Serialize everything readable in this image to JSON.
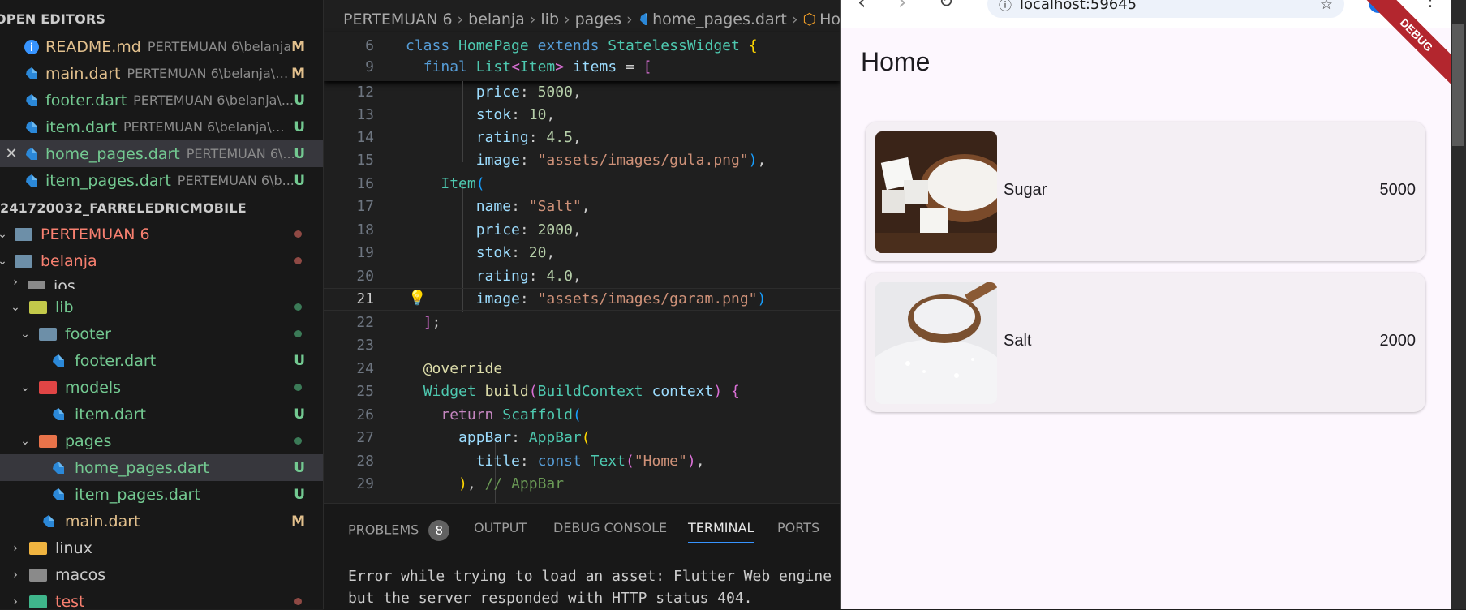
{
  "sidebar": {
    "open_editors_title": "OPEN EDITORS",
    "open_editors": [
      {
        "name": "README.md",
        "path": "PERTEMUAN 6\\belanja",
        "badge": "M",
        "icon": "info-icon"
      },
      {
        "name": "main.dart",
        "path": "PERTEMUAN 6\\belanja\\lib",
        "badge": "M",
        "icon": "dart-icon"
      },
      {
        "name": "footer.dart",
        "path": "PERTEMUAN 6\\belanja\\...",
        "badge": "U",
        "icon": "dart-icon"
      },
      {
        "name": "item.dart",
        "path": "PERTEMUAN 6\\belanja\\li...",
        "badge": "U",
        "icon": "dart-icon"
      },
      {
        "name": "home_pages.dart",
        "path": "PERTEMUAN 6\\...",
        "badge": "U",
        "icon": "dart-icon"
      },
      {
        "name": "item_pages.dart",
        "path": "PERTEMUAN 6\\b...",
        "badge": "U",
        "icon": "dart-icon"
      }
    ],
    "workspace_title": "241720032_FARRELEDRICMOBILE",
    "tree": [
      {
        "label": "PERTEMUAN 6"
      },
      {
        "label": "belanja"
      },
      {
        "label": "ios"
      },
      {
        "label": "lib"
      },
      {
        "label": "footer"
      },
      {
        "label": "footer.dart",
        "badge": "U"
      },
      {
        "label": "models"
      },
      {
        "label": "item.dart",
        "badge": "U"
      },
      {
        "label": "pages"
      },
      {
        "label": "home_pages.dart",
        "badge": "U"
      },
      {
        "label": "item_pages.dart",
        "badge": "U"
      },
      {
        "label": "main.dart",
        "badge": "M"
      },
      {
        "label": "linux"
      },
      {
        "label": "macos"
      },
      {
        "label": "test"
      }
    ]
  },
  "editor": {
    "breadcrumbs": [
      "PERTEMUAN 6",
      "belanja",
      "lib",
      "pages",
      "home_pages.dart",
      "Ho"
    ],
    "line_numbers": [
      "6",
      "9",
      "12",
      "13",
      "14",
      "15",
      "16",
      "17",
      "18",
      "19",
      "20",
      "21",
      "22",
      "23",
      "24",
      "25",
      "26",
      "27",
      "28",
      "29"
    ]
  },
  "panel": {
    "tabs": [
      "PROBLEMS",
      "OUTPUT",
      "DEBUG CONSOLE",
      "TERMINAL",
      "PORTS"
    ],
    "problems_count": "8",
    "terminal_lines": [
      "Error while trying to load an asset: Flutter Web engine",
      "but the server responded with HTTP status 404."
    ]
  },
  "browser": {
    "url": "localhost:59645",
    "app_title": "Home",
    "debug_banner": "DEBUG",
    "items": [
      {
        "name": "Sugar",
        "price": "5000"
      },
      {
        "name": "Salt",
        "price": "2000"
      }
    ]
  }
}
